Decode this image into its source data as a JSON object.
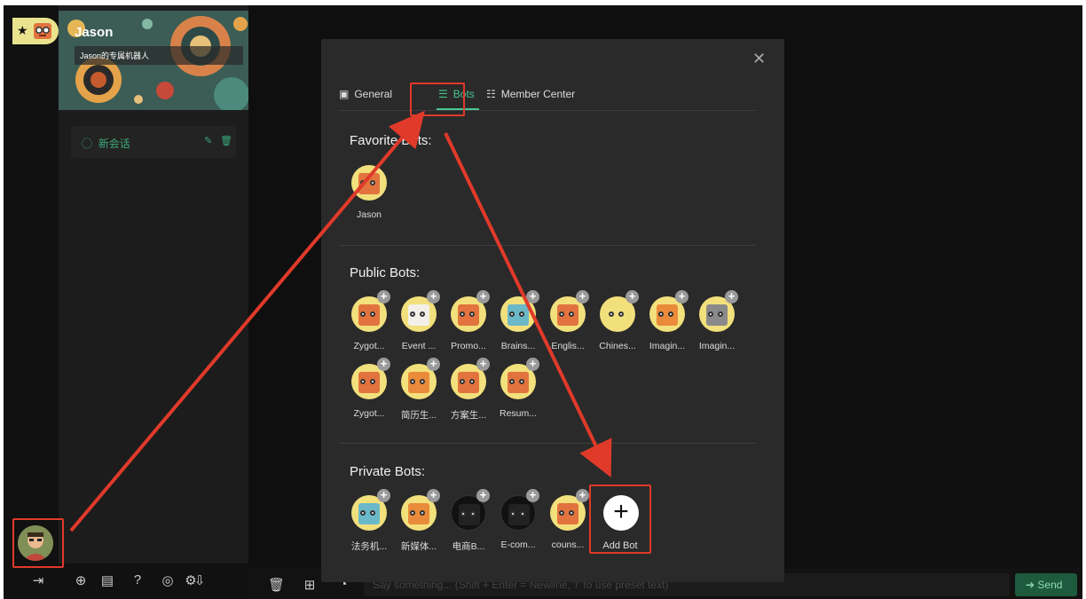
{
  "sidebar": {
    "bot_name": "Jason",
    "bot_subtitle": "Jason的专属机器人",
    "session_label": "新会话"
  },
  "chat": {
    "input_placeholder": "Say something... (Shift + Enter = Newline, '/' to use preset text)",
    "send_label": "Send"
  },
  "modal": {
    "tabs": [
      {
        "label": "General",
        "icon": "document-icon"
      },
      {
        "label": "Bots",
        "icon": "sliders-icon"
      },
      {
        "label": "Member Center",
        "icon": "list-settings-icon"
      }
    ],
    "active_tab": "Bots",
    "favorite_title": "Favorite Bots:",
    "favorite_bots": [
      {
        "name": "Jason"
      }
    ],
    "public_title": "Public Bots:",
    "public_bots": [
      {
        "name": "Zygot..."
      },
      {
        "name": "Event ..."
      },
      {
        "name": "Promo..."
      },
      {
        "name": "Brains..."
      },
      {
        "name": "Englis..."
      },
      {
        "name": "Chines..."
      },
      {
        "name": "Imagin..."
      },
      {
        "name": "Imagin..."
      },
      {
        "name": "Zygot..."
      },
      {
        "name": "简历生..."
      },
      {
        "name": "方案生..."
      },
      {
        "name": "Resum..."
      }
    ],
    "private_title": "Private Bots:",
    "private_bots": [
      {
        "name": "法务机..."
      },
      {
        "name": "新媒体..."
      },
      {
        "name": "电商B..."
      },
      {
        "name": "E-com..."
      },
      {
        "name": "couns..."
      }
    ],
    "add_bot_label": "Add Bot"
  },
  "colors": {
    "accent": "#48c78e",
    "annotation": "#e03a2a",
    "modal_bg": "#2a2a2a",
    "page_bg": "#0f0f0f"
  }
}
